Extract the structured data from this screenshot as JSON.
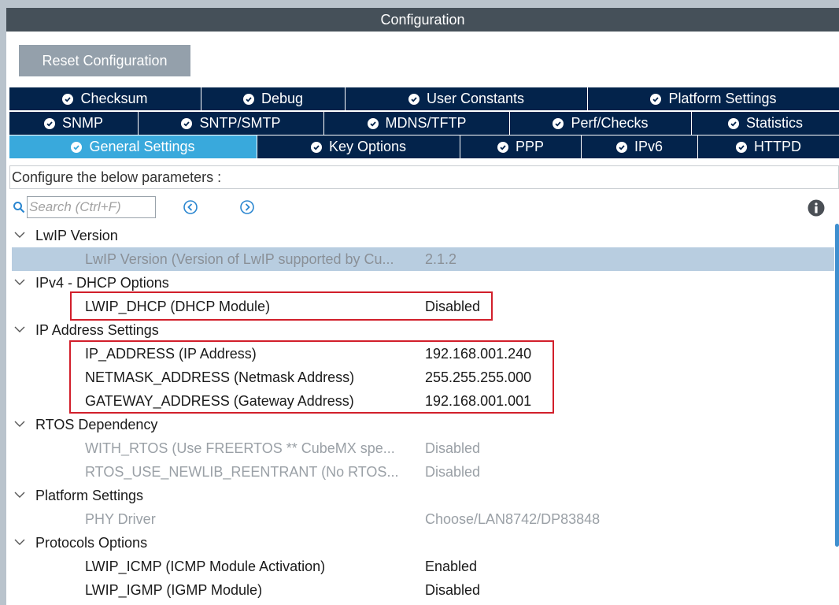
{
  "window": {
    "title": "Configuration"
  },
  "toolbar": {
    "reset_label": "Reset Configuration"
  },
  "tabs": {
    "row1": [
      {
        "label": "Checksum"
      },
      {
        "label": "Debug"
      },
      {
        "label": "User Constants"
      },
      {
        "label": "Platform Settings"
      }
    ],
    "row2": [
      {
        "label": "SNMP"
      },
      {
        "label": "SNTP/SMTP"
      },
      {
        "label": "MDNS/TFTP"
      },
      {
        "label": "Perf/Checks"
      },
      {
        "label": "Statistics"
      }
    ],
    "row3": [
      {
        "label": "General Settings"
      },
      {
        "label": "Key Options"
      },
      {
        "label": "PPP"
      },
      {
        "label": "IPv6"
      },
      {
        "label": "HTTPD"
      }
    ],
    "active": "General Settings"
  },
  "config": {
    "caption": "Configure the below parameters :",
    "search_placeholder": "Search (Ctrl+F)"
  },
  "tree": {
    "groups": [
      {
        "label": "LwIP Version"
      },
      {
        "label": "IPv4 - DHCP Options"
      },
      {
        "label": "IP Address Settings"
      },
      {
        "label": "RTOS Dependency"
      },
      {
        "label": "Platform Settings"
      },
      {
        "label": "Protocols Options"
      }
    ],
    "params": [
      {
        "name": "LwIP Version (Version of LwIP supported by Cu...",
        "value": "2.1.2"
      },
      {
        "name": "LWIP_DHCP (DHCP Module)",
        "value": "Disabled"
      },
      {
        "name": "IP_ADDRESS (IP Address)",
        "value": "192.168.001.240"
      },
      {
        "name": "NETMASK_ADDRESS (Netmask Address)",
        "value": "255.255.255.000"
      },
      {
        "name": "GATEWAY_ADDRESS (Gateway Address)",
        "value": "192.168.001.001"
      },
      {
        "name": "WITH_RTOS (Use FREERTOS ** CubeMX spe...",
        "value": "Disabled"
      },
      {
        "name": "RTOS_USE_NEWLIB_REENTRANT (No RTOS...",
        "value": "Disabled"
      },
      {
        "name": "PHY Driver",
        "value": "Choose/LAN8742/DP83848"
      },
      {
        "name": "LWIP_ICMP (ICMP Module Activation)",
        "value": "Enabled"
      },
      {
        "name": "LWIP_IGMP (IGMP Module)",
        "value": "Disabled"
      }
    ]
  },
  "icons": {
    "check": "check-circle-icon",
    "search": "search-icon",
    "prev": "chevron-left-circle-icon",
    "next": "chevron-right-circle-icon",
    "info": "info-icon",
    "expand": "chevron-down-icon"
  },
  "colors": {
    "tab_bg": "#03234b",
    "tab_active": "#39a9dc",
    "highlight": "#d21f2b",
    "selected_row": "#b8cde0"
  }
}
